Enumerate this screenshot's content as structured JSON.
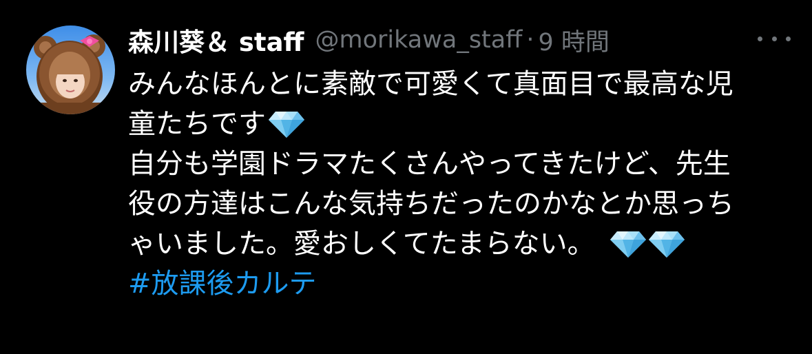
{
  "tweet": {
    "display_name": "森川葵＆ staff",
    "handle": "@morikawa_staff",
    "separator": "·",
    "time": "9 時間",
    "lines": [
      "みんなほんとに素敵で可愛くて真面目で最高な児",
      "童たちです",
      "自分も学園ドラマたくさんやってきたけど、先生",
      "役の方達はこんな気持ちだったのかなとか思っち",
      "ゃいました。愛おしくてたまらない。"
    ],
    "hashtag": "#放課後カルテ",
    "emoji": "gem-stone-icon"
  },
  "colors": {
    "background": "#000000",
    "text": "#ffffff",
    "secondary": "#71767b",
    "link": "#1d9bf0"
  }
}
